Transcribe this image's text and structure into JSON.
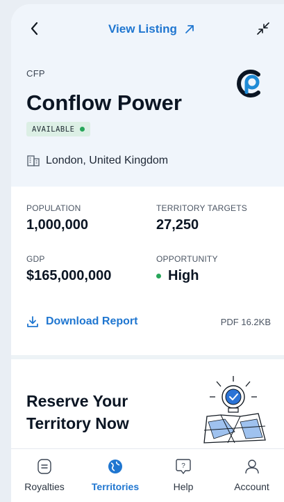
{
  "header": {
    "view_listing_label": "View Listing"
  },
  "listing": {
    "ticker": "CFP",
    "name": "Conflow Power",
    "status": "AVAILABLE",
    "status_color": "#27a65a",
    "location": "London, United Kingdom"
  },
  "stats": {
    "population_label": "POPULATION",
    "population_value": "1,000,000",
    "targets_label": "TERRITORY TARGETS",
    "targets_value": "27,250",
    "gdp_label": "GDP",
    "gdp_value": "$165,000,000",
    "opportunity_label": "OPPORTUNITY",
    "opportunity_value": "High"
  },
  "report": {
    "download_label": "Download Report",
    "file_info": "PDF 16.2KB"
  },
  "reserve": {
    "title_line1": "Reserve Your",
    "title_line2": "Territory Now"
  },
  "tabbar": {
    "tabs": [
      {
        "label": "Royalties",
        "icon": "royalties-icon"
      },
      {
        "label": "Territories",
        "icon": "globe-icon"
      },
      {
        "label": "Help",
        "icon": "help-icon"
      },
      {
        "label": "Account",
        "icon": "account-icon"
      }
    ],
    "active_index": 1
  },
  "colors": {
    "accent": "#1f76d0",
    "success": "#27a65a",
    "header_bg": "#f0f5fb"
  }
}
